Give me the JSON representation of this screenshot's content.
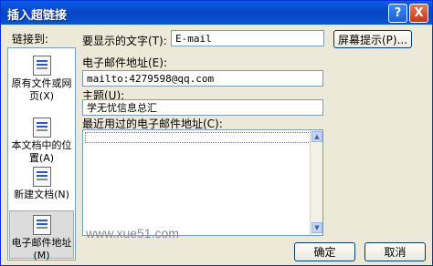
{
  "window": {
    "title": "插入超链接"
  },
  "title_buttons": {
    "help": "?",
    "close": "X"
  },
  "sidebar": {
    "heading": "链接到:",
    "items": [
      {
        "label": "原有文件或网页(X)",
        "line1": "原有文件或网",
        "line2": "页(X)"
      },
      {
        "label": "本文档中的位置(A)",
        "line1": "本文档中的位",
        "line2": "置(A)"
      },
      {
        "label": "新建文档(N)",
        "line1": "新建文档(N)",
        "line2": ""
      },
      {
        "label": "电子邮件地址(M)",
        "line1": "电子邮件地址",
        "line2": "(M)"
      }
    ]
  },
  "display_text": {
    "label": "要显示的文字(T):",
    "value": "E-mail"
  },
  "screentip_button": "屏幕提示(P)...",
  "email": {
    "label": "电子邮件地址(E):",
    "value": "mailto:4279598@qq.com"
  },
  "subject": {
    "label": "主题(U):",
    "value": "学无忧信息总汇"
  },
  "recent": {
    "label": "最近用过的电子邮件地址(C):"
  },
  "watermark": "www.xue51.com",
  "ok_button": "确定",
  "cancel_button": "取消"
}
